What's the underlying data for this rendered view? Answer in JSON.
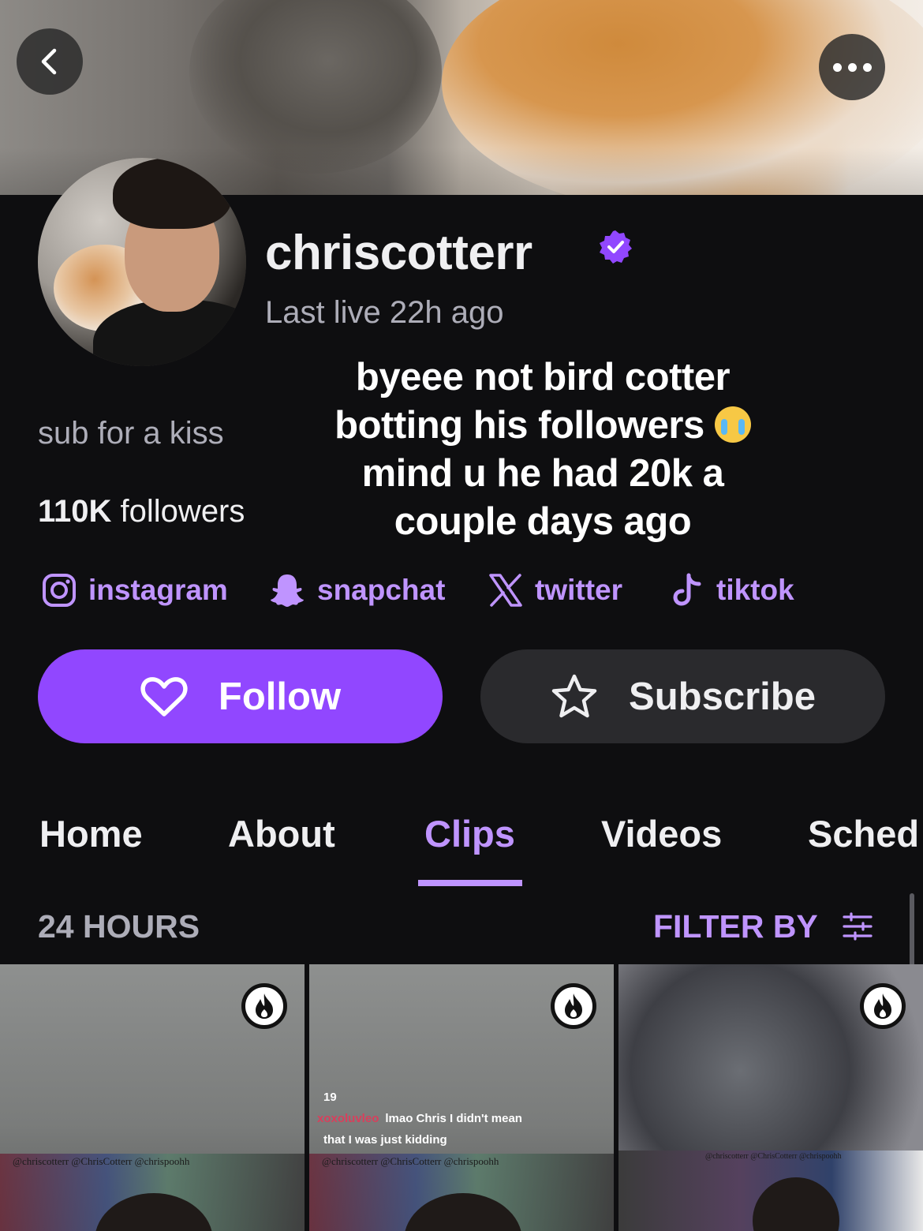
{
  "profile": {
    "username": "chriscotterr",
    "verified": true,
    "last_live": "Last live 22h ago",
    "bio": "sub for a kiss",
    "followers_count": "110K",
    "followers_label": "followers"
  },
  "overlay_caption": {
    "line1": "byeee not bird cotter",
    "line2": "botting his followers",
    "line2_emoji": "loudly-crying-face-emoji",
    "line3": "mind u he had 20k a",
    "line4": "couple days ago"
  },
  "socials": [
    {
      "label": "instagram",
      "icon": "instagram-icon"
    },
    {
      "label": "snapchat",
      "icon": "snapchat-icon"
    },
    {
      "label": "twitter",
      "icon": "x-icon"
    },
    {
      "label": "tiktok",
      "icon": "tiktok-icon"
    }
  ],
  "actions": {
    "follow_label": "Follow",
    "subscribe_label": "Subscribe"
  },
  "tabs": [
    {
      "label": "Home",
      "active": false
    },
    {
      "label": "About",
      "active": false
    },
    {
      "label": "Clips",
      "active": true
    },
    {
      "label": "Videos",
      "active": false
    },
    {
      "label": "Sched",
      "active": false
    }
  ],
  "clips_section": {
    "range_label": "24 HOURS",
    "filter_label": "FILTER BY"
  },
  "clips": [
    {
      "badge": "hot-flame-icon",
      "handles": "@chriscotterr  @ChrisCotterr  @chrispoohh"
    },
    {
      "badge": "hot-flame-icon",
      "handles": "@chriscotterr  @ChrisCotterr  @chrispoohh",
      "chat": [
        {
          "name": "",
          "message": "19"
        },
        {
          "name": "xoxoluvleo",
          "message": "lmao Chris I didn't mean"
        },
        {
          "name": "",
          "message": "that I was just kidding"
        }
      ]
    },
    {
      "badge": "hot-flame-icon",
      "handles": "@chriscotterr  @ChrisCotterr  @chrispoohh"
    }
  ],
  "colors": {
    "accent": "#9147ff",
    "accent_text": "#bf94ff",
    "background": "#0e0e10",
    "muted_text": "#adadb8",
    "secondary_button": "#2a2a2d"
  }
}
